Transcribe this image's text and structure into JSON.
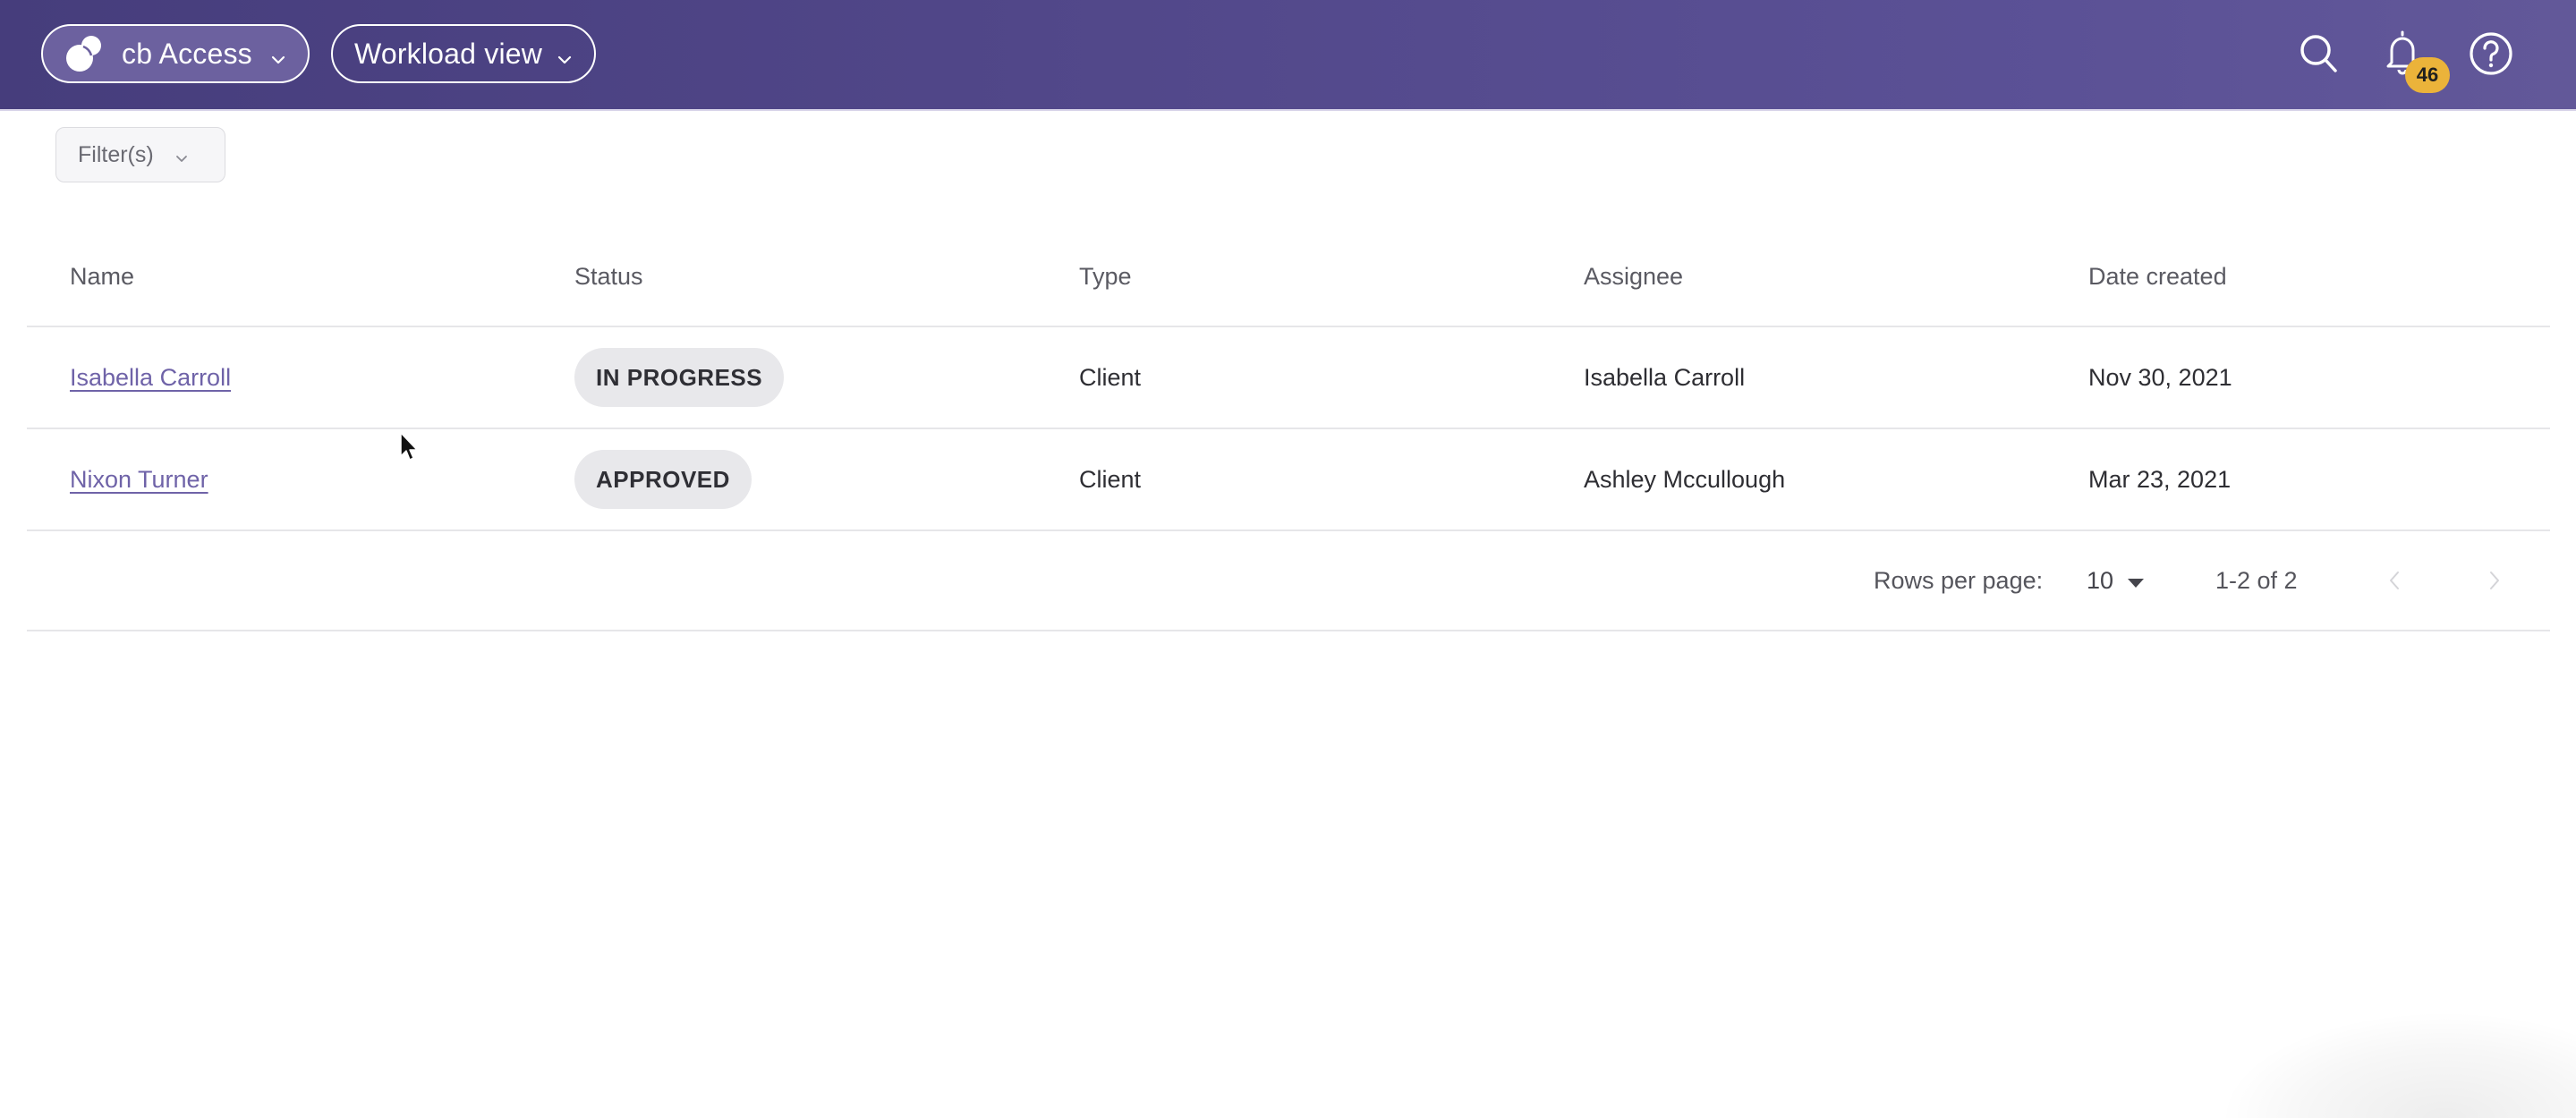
{
  "header": {
    "app_switcher": {
      "label": "cb Access",
      "icon": "logo-bubbles-icon"
    },
    "view_switcher": {
      "label": "Workload view"
    },
    "actions": {
      "search_icon": "search-icon",
      "notifications_icon": "bell-icon",
      "notifications_count": "46",
      "help_icon": "help-circle-icon"
    },
    "colors": {
      "bar_start": "#463d7c",
      "bar_end": "#625899",
      "badge": "#ebb33a"
    }
  },
  "filters": {
    "label": "Filter(s)"
  },
  "table": {
    "columns": [
      "Name",
      "Status",
      "Type",
      "Assignee",
      "Date created"
    ],
    "rows": [
      {
        "name": "Isabella Carroll",
        "status": "IN PROGRESS",
        "type": "Client",
        "assignee": "Isabella Carroll",
        "date_created": "Nov 30, 2021"
      },
      {
        "name": "Nixon Turner",
        "status": "APPROVED",
        "type": "Client",
        "assignee": "Ashley Mccullough",
        "date_created": "Mar 23, 2021"
      }
    ]
  },
  "pagination": {
    "rows_per_page_label": "Rows per page:",
    "rows_per_page_value": "10",
    "range_label": "1-2 of 2",
    "prev_enabled": false,
    "next_enabled": false
  }
}
